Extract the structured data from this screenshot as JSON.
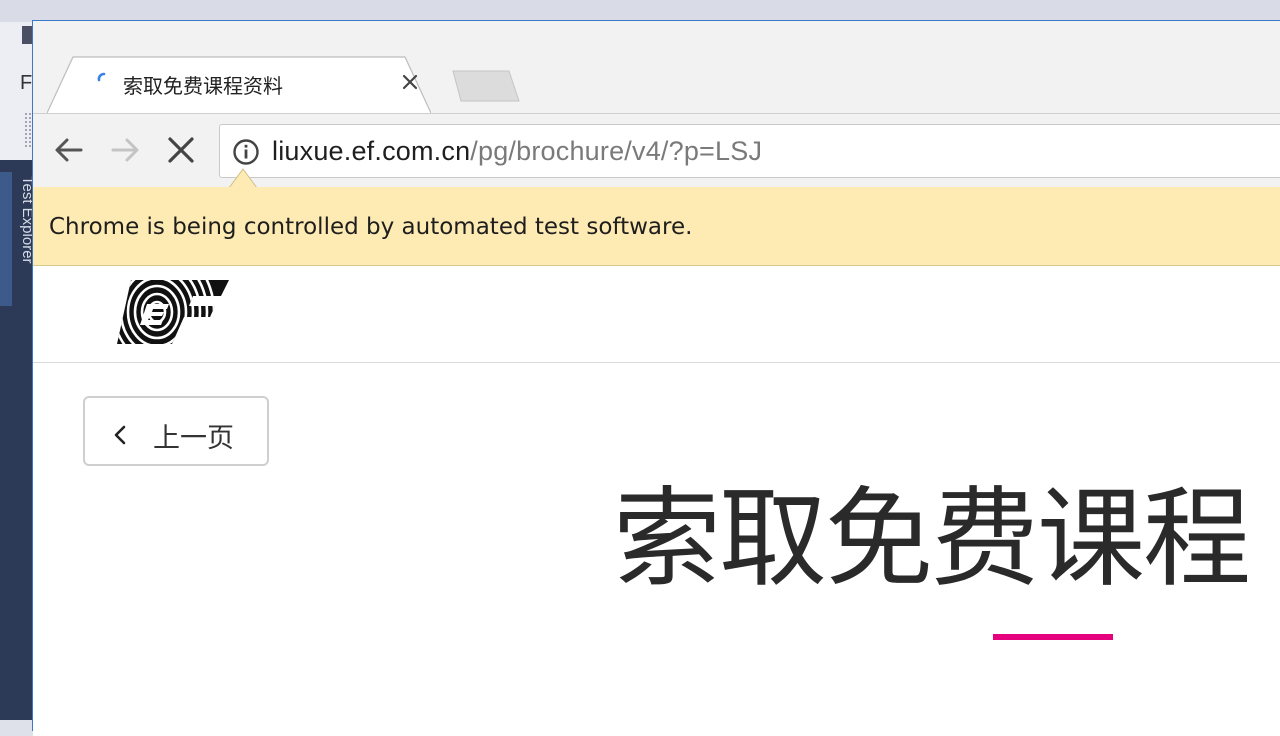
{
  "background": {
    "ide_panel_label": "Test Explorer",
    "ide_menu_letter": "F"
  },
  "browser": {
    "tab": {
      "title": "索取免费课程资料",
      "close_icon": "close-icon",
      "loading": true
    },
    "toolbar": {
      "back_icon": "arrow-left-icon",
      "forward_icon": "arrow-right-icon",
      "stop_icon": "close-icon",
      "info_icon": "info-icon",
      "url_host": "liuxue.ef.com.cn",
      "url_path": "/pg/brochure/v4/?p=LSJ"
    },
    "infobar": {
      "message": "Chrome is being controlled by automated test software."
    }
  },
  "page": {
    "logo": "EF",
    "back_button_label": "上一页",
    "hero_title": "索取免费课程",
    "accent_color": "#e5007e"
  }
}
